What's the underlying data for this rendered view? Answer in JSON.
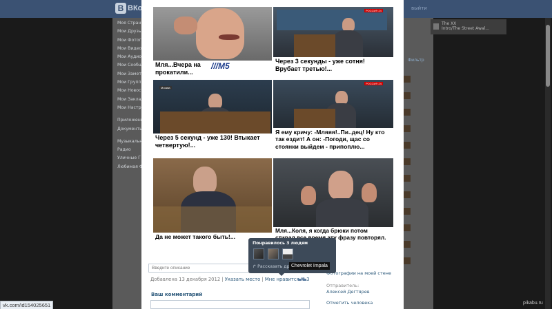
{
  "background": {
    "logo": "ВКо",
    "exit_label": "выйти",
    "sidebar": [
      "Моя Страни",
      "Мои Друзья",
      "Мои Фотогр",
      "Мои Видеоз",
      "Мои Аудиоз",
      "Мои Сообщ",
      "Мои Замет",
      "Мои Группы",
      "Мои Новост",
      "Мои Заклад",
      "Мои Настро",
      "",
      "Приложени",
      "Документы",
      "",
      "Музыкальн",
      "Радио",
      "Уличные Г",
      "Любимая Ф"
    ],
    "music": {
      "artist": "The XX",
      "track": "Intro/The Street Awal..."
    },
    "filter_label": "Фильтр"
  },
  "meme": {
    "panels": [
      {
        "caption": "Мля...Вчера на\nпрокатили...",
        "logo_text": "///M5"
      },
      {
        "caption": "Через 3 секунды - уже сотня!\nВрубает третью!..."
      },
      {
        "caption": "Через 5 секунд - уже 130! Втыкает\nчетвертую!..."
      },
      {
        "caption": "Я ему кричу: -Мляяя!..Пи..дец! Ну кто\nтак ездит! А он: -Погоди, щас со\nстоянки выйдем - припоплю..."
      },
      {
        "caption": "Да не может такого быть!..."
      },
      {
        "caption": "Мля...Коля, я когда брюки потом\nстирал все время эту фразу повторял."
      }
    ],
    "channel_badge": "РОССИЯ 24",
    "channel_badge_2": "Москва"
  },
  "description_placeholder": "Введите описание",
  "meta": {
    "date": "Добавлена 13 декабря 2012",
    "sep": " | ",
    "location_link": "Указать место",
    "like_link": "Мне нравится",
    "like_count": "3"
  },
  "comment_label": "Ваш комментарий",
  "right": {
    "wall_link": "Фотографии на моей стене",
    "sender_label": "Отправитель:",
    "sender_name": "Алексей Дегтярев",
    "tag_link": "Отметить человека"
  },
  "likes_popup": {
    "title": "Понравилось 3 людям",
    "share_label": "Рассказать друзьям"
  },
  "tooltip": "Chevrolet Impala",
  "status_url": "vk.com/id154025651",
  "watermark": "pikabu.ru"
}
